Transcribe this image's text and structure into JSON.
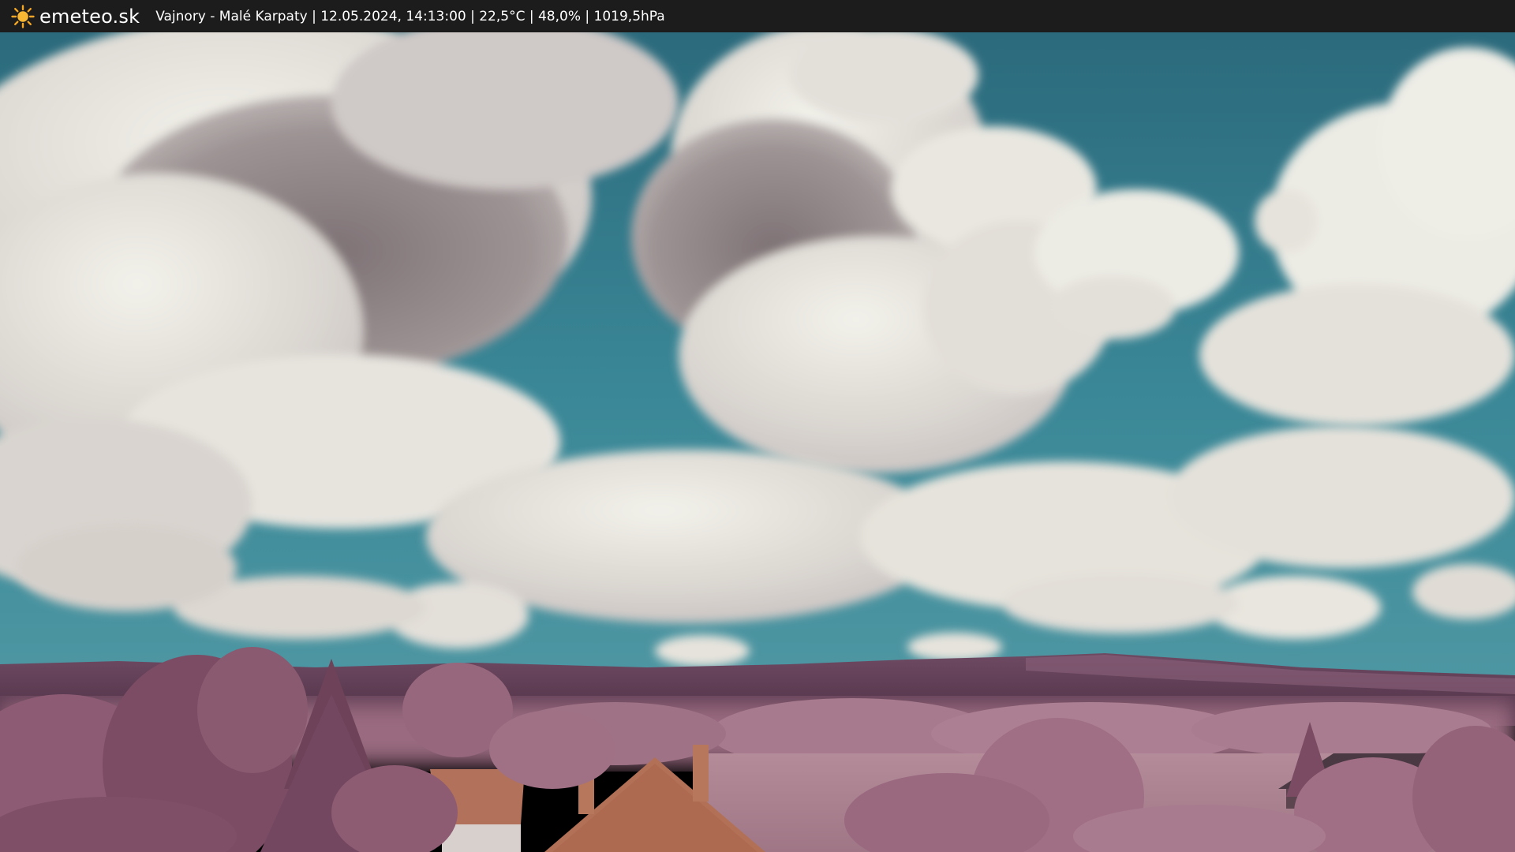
{
  "header": {
    "brand": "emeteo.sk",
    "logo_icon": "sun-icon",
    "caption": "Vajnory - Malé Karpaty | 12.05.2024, 14:13:00 | 22,5°C | 48,0% | 1019,5hPa"
  },
  "scene": {
    "subject": "webcam-infrared-sky-view",
    "colors": {
      "sky": "#3d8a99",
      "sky_top": "#2d6f80",
      "cloud_light": "#ecebe4",
      "cloud_shadow": "#8f8587",
      "hills": "#5e3d54",
      "foliage": "#a7788d",
      "field": "#b48c99",
      "roof": "#b2715a",
      "topbar": "#1c1c1c"
    }
  }
}
